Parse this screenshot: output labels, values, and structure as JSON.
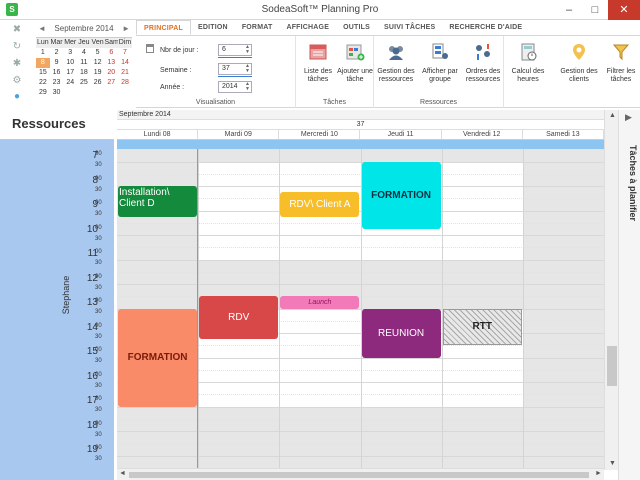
{
  "window": {
    "title": "SodeaSoft™ Planning Pro",
    "app_icon": "S",
    "min": "–",
    "max": "□",
    "close": "✕"
  },
  "quick_access": [
    {
      "name": "close-icon",
      "glyph": "✖"
    },
    {
      "name": "refresh-icon",
      "glyph": "↻"
    },
    {
      "name": "settings-icon",
      "glyph": "✱"
    },
    {
      "name": "tools-icon",
      "glyph": "⚙"
    },
    {
      "name": "dot-icon",
      "glyph": "●"
    }
  ],
  "mini_calendar": {
    "title": "Septembre 2014",
    "prev": "◄",
    "next": "►",
    "days_of_week": [
      "Lun",
      "Mar",
      "Mer",
      "Jeu",
      "Ven",
      "Sam",
      "Dim"
    ],
    "weeks": [
      [
        "1",
        "2",
        "3",
        "4",
        "5",
        "6",
        "7"
      ],
      [
        "8",
        "9",
        "10",
        "11",
        "12",
        "13",
        "14"
      ],
      [
        "15",
        "16",
        "17",
        "18",
        "19",
        "20",
        "21"
      ],
      [
        "22",
        "23",
        "24",
        "25",
        "26",
        "27",
        "28"
      ],
      [
        "29",
        "30",
        "",
        "",
        "",
        "",
        ""
      ]
    ],
    "selected": "8"
  },
  "tabs": [
    "PRINCIPAL",
    "EDITION",
    "FORMAT",
    "AFFICHAGE",
    "OUTILS",
    "SUIVI TÂCHES",
    "RECHERCHE D'AIDE"
  ],
  "active_tab": "PRINCIPAL",
  "visualisation": {
    "label": "Visualisation",
    "nb_jour_label": "Nbr de jour :",
    "nb_jour": "6",
    "semaine_label": "Semaine :",
    "semaine": "37",
    "annee_label": "Année :",
    "annee": "2014"
  },
  "taches_group": {
    "label": "Tâches",
    "buttons": [
      {
        "label": "Liste des tâches",
        "icon": "task-list-icon"
      },
      {
        "label": "Ajouter une tâche",
        "icon": "add-task-icon"
      }
    ]
  },
  "ressources_group": {
    "label": "Ressources",
    "buttons": [
      {
        "label": "Gestion des ressources",
        "icon": "resources-icon"
      },
      {
        "label": "Afficher par groupe",
        "icon": "group-icon"
      },
      {
        "label": "Ordres des ressources",
        "icon": "order-icon"
      }
    ]
  },
  "other_buttons": [
    {
      "label": "Calcul des heures",
      "icon": "calculator-icon"
    },
    {
      "label": "Gestion des clients",
      "icon": "clients-icon"
    },
    {
      "label": "Filtrer les tâches",
      "icon": "filter-icon"
    }
  ],
  "resources_panel": {
    "title": "Ressources",
    "resource_name": "Stephane",
    "hours": [
      "7",
      "8",
      "9",
      "10",
      "11",
      "12",
      "13",
      "14",
      "15",
      "16",
      "17",
      "18",
      "19"
    ],
    "half": "30",
    "full": "00"
  },
  "calendar": {
    "month": "Septembre 2014",
    "week": "37",
    "days": [
      "Lundi 08",
      "Mardi 09",
      "Mercredi 10",
      "Jeudi 11",
      "Vendredi 12",
      "Samedi 13"
    ]
  },
  "appointments": [
    {
      "name": "appt-installation",
      "text": "Installation\\ Client D",
      "color": "#138a3c",
      "day": 0,
      "start": 9.0,
      "end": 10.25,
      "text_color": "#ffffff",
      "align": "left"
    },
    {
      "name": "appt-formation-lundi",
      "text": "FORMATION",
      "color": "#f98b68",
      "day": 0,
      "start": 14.0,
      "end": 18.0,
      "text_color": "#7a1a0a",
      "bold": true
    },
    {
      "name": "appt-rdv-mardi",
      "text": "RDV",
      "color": "#d94848",
      "day": 1,
      "start": 13.5,
      "end": 15.25,
      "text_color": "#ffffff"
    },
    {
      "name": "appt-rdv-client-a",
      "text": "RDV\\ Client A",
      "color": "#f8be2a",
      "day": 2,
      "start": 9.25,
      "end": 10.25,
      "text_color": "#ffffff"
    },
    {
      "name": "appt-launch",
      "text": "Launch",
      "color": "#f27ab8",
      "day": 2,
      "start": 13.5,
      "end": 14.0,
      "text_color": "#9a1060",
      "italic": true,
      "small": true
    },
    {
      "name": "appt-formation-jeudi",
      "text": "FORMATION",
      "color": "#00e5e8",
      "day": 3,
      "start": 8.0,
      "end": 10.75,
      "text_color": "#103040",
      "bold": true
    },
    {
      "name": "appt-reunion",
      "text": "REUNION",
      "color": "#8e2a7e",
      "day": 3,
      "start": 14.0,
      "end": 16.0,
      "text_color": "#ffffff"
    },
    {
      "name": "appt-rtt",
      "text": "RTT",
      "color": "hatch",
      "day": 4,
      "start": 14.0,
      "end": 15.5,
      "text_color": "#222222",
      "bold": true
    }
  ],
  "right_panel": {
    "label": "Tâches à planifier",
    "pin": "▶"
  }
}
